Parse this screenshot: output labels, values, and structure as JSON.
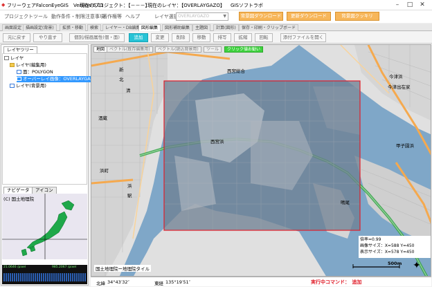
{
  "titlebar": {
    "app_title": "フリーウェアFalconEyeGIS　Version 6.01",
    "project": "現在のプロジェクト：【－－－】",
    "layer": "現在のレイヤ：【OVERLAYGAZO】",
    "vendor": "GISソフトラボ"
  },
  "menubar": {
    "items": [
      "プロジェクト",
      "ツール",
      "動作条件・制限注意事項",
      "著作権等",
      "ヘルプ"
    ],
    "layer_label": "レイヤ選択",
    "layer_value": "OVERLAYGAZO",
    "download_label": "背景図ダウンロード",
    "update_label": "更新ダウンロード",
    "sharpen_label": "背景図クッキリ"
  },
  "tabs": [
    "画面設定",
    "描画設定(背景)",
    "拡張・移動",
    "検索",
    "レイヤー・DB編集",
    "図形編集",
    "図形補助編集",
    "主題図",
    "計算(図形)",
    "保存・印刷・クリップボード"
  ],
  "toolbar": {
    "undo": "元に戻す",
    "redo": "やり直す",
    "attr": "個別/描画属性(個・面)",
    "add": "追加",
    "modify": "変更",
    "delete": "削除",
    "move": "移動",
    "sort": "排写",
    "scale": "拡縮",
    "rotate": "回転",
    "attach": "添付ファイルを開く"
  },
  "leftpanel": {
    "tab_layers": "レイヤツリー",
    "root": "レイヤ",
    "edit_group": "レイヤ(編集用)",
    "polygon": "面：POLYGON",
    "overlay": "オーバーレイ画像：OVERLAYGAZO",
    "bg_group": "レイヤ(背景用)",
    "tab_navi": "ナビゲータ",
    "tab_icon": "アイコン",
    "copyright": "(C) 国土地理院",
    "coord_left": "21.0646 /pixel",
    "coord_right": "985.2067 /pixel"
  },
  "map": {
    "tab_map": "地図",
    "tab_vector_edit": "ベクトル(既存編集用)",
    "tab_vector_bg": "ベクトル(読込背景用)",
    "tab_tool": "ツール",
    "tab_green": "クリック値お勧い",
    "label_nishitomi": "西宮総合",
    "label_nishinomiya": "西宮浜",
    "label_imazu_minami": "今津浜",
    "label_imazu": "今津出在家",
    "label_kakihama": "甲子園浜",
    "label_hamamachi": "浜町",
    "label_tsuru": "鳴尾",
    "label_sake": "酒蔵",
    "label_kiyo": "清",
    "label_hama": "浜",
    "label_eki": "駅",
    "label_shin": "新",
    "label_kita": "北",
    "info_ratio": "倍率=0.99",
    "info_img": "画像サイズ：X=588 Y=450",
    "info_disp": "表示サイズ：X=578 Y=450",
    "scale": "500m",
    "attribution": "国土地理院ー地理院タイル"
  },
  "status": {
    "lat_label": "北緯",
    "lat": "34°43′32″",
    "lon_label": "東経",
    "lon": "135°19′51″",
    "command": "実行中コマンド：　追加"
  }
}
